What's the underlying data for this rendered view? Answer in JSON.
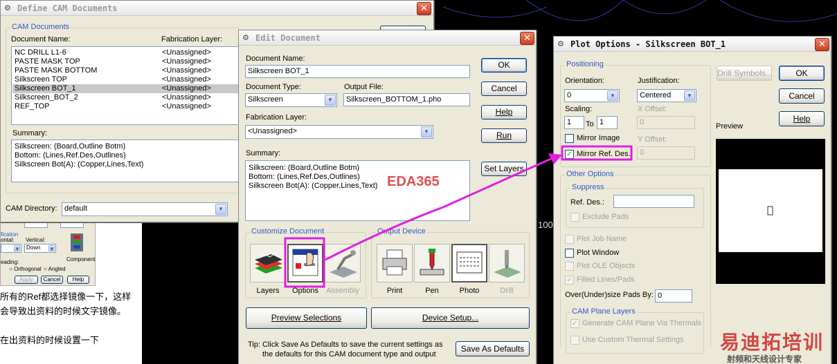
{
  "background": {
    "canvas_label": "100"
  },
  "behind_panel": {
    "label_fication": "fication",
    "label_ontal": "ontal:",
    "label_vertical": "Vertical:",
    "vertical_value": "Down",
    "label_eading": "eading:",
    "radio_orthogonal": "Orthogonal",
    "radio_angled": "Angled",
    "component_label": "Component",
    "btn_apply": "Apply",
    "btn_cancel": "Cancel",
    "btn_help": "Help",
    "note_line1": "所有的Ref都选择镜像一下，这样",
    "note_line2": "会导致出资料的时候文字镜像。",
    "note_line3": "在出资料的时候设置一下"
  },
  "define_cam": {
    "title": "Define CAM Documents",
    "group_label": "CAM Documents",
    "col_doc_name": "Document Name:",
    "col_fab_layer": "Fabrication Layer:",
    "documents": [
      {
        "name": "NC DRILL L1-6",
        "layer": "<Unassigned>"
      },
      {
        "name": "PASTE MASK TOP",
        "layer": "<Unassigned>"
      },
      {
        "name": "PASTE MASK BOTTOM",
        "layer": "<Unassigned>"
      },
      {
        "name": "Silkscreen TOP",
        "layer": "<Unassigned>"
      },
      {
        "name": "Silkscreen BOT_1",
        "layer": "<Unassigned>"
      },
      {
        "name": "Silkscreen_BOT_2",
        "layer": "<Unassigned>"
      },
      {
        "name": "REF_TOP",
        "layer": "<Unassigned>"
      }
    ],
    "summary_label": "Summary:",
    "summary_text": "Silkscreen: (Board,Outline Botm)\nBottom: (Lines,Ref.Des,Outlines)\nSilkscreen Bot(A): (Copper,Lines,Text)",
    "cam_dir_label": "CAM Directory:",
    "cam_dir_value": "default"
  },
  "edit_doc": {
    "title": "Edit Document",
    "doc_name_label": "Document Name:",
    "doc_name_value": "Silkscreen BOT_1",
    "doc_type_label": "Document Type:",
    "doc_type_value": "Silkscreen",
    "output_file_label": "Output File:",
    "output_file_value": "Silkscreen_BOTTOM_1.pho",
    "fab_layer_label": "Fabrication Layer:",
    "fab_layer_value": "<Unassigned>",
    "summary_label": "Summary:",
    "summary_text": "Silkscreen: (Board,Outline Botm)\nBottom: (Lines,Ref.Des,Outlines)\nSilkscreen Bot(A): (Copper,Lines,Text)",
    "watermark": "EDA365",
    "btn_ok": "OK",
    "btn_cancel": "Cancel",
    "btn_help": "Help",
    "btn_run": "Run",
    "btn_set_layers": "Set Layers",
    "customize_label": "Customize Document",
    "tool_layers": "Layers",
    "tool_options": "Options",
    "tool_assembly": "Assembly",
    "output_device_label": "Output Device",
    "dev_print": "Print",
    "dev_pen": "Pen",
    "dev_photo": "Photo",
    "dev_drill": "Drill",
    "btn_preview": "Preview Selections",
    "btn_device_setup": "Device Setup...",
    "tip_line1": "Tip: Click Save As Defaults to save the current settings as",
    "tip_line2": "the defaults for this CAM document type and output",
    "btn_save_defaults": "Save As Defaults"
  },
  "plot_opts": {
    "title": "Plot Options - Silkscreen BOT_1",
    "positioning_label": "Positioning",
    "orientation_label": "Orientation:",
    "orientation_value": "0",
    "justification_label": "Justification:",
    "justification_value": "Centered",
    "scaling_label": "Scaling:",
    "scale_from": "1",
    "to_label": "To",
    "scale_to": "1",
    "x_offset_label": "X Offset:",
    "x_offset_value": "0",
    "y_offset_label": "Y Offset:",
    "y_offset_value": "0",
    "mirror_image_label": "Mirror Image",
    "mirror_image_checked": false,
    "mirror_ref_label": "Mirror Ref. Des.",
    "mirror_ref_checked": true,
    "btn_drill_symbols": "Drill Symbols...",
    "btn_ok": "OK",
    "btn_cancel": "Cancel",
    "btn_help": "Help",
    "preview_label": "Preview",
    "other_options_label": "Other Options",
    "suppress_label": "Suppress",
    "ref_des_label": "Ref. Des.:",
    "ref_des_value": "",
    "exclude_pads_label": "Exclude Pads",
    "plot_job_name_label": "Plot Job Name",
    "plot_window_label": "Plot Window",
    "plot_ole_label": "Plot OLE Objects",
    "filled_lines_label": "Filled Lines/Pads",
    "filled_lines_checked": true,
    "overunder_label": "Over(Under)size Pads By:",
    "overunder_value": "0",
    "cam_plane_label": "CAM Plane Layers",
    "gen_cam_plane_label": "Generate CAM Plane Via Thermals",
    "gen_cam_plane_checked": true,
    "custom_thermal_label": "Use Custom Thermal Settings"
  },
  "site_watermark": {
    "line1": "易迪拓培训",
    "line2": "射频和天线设计专家"
  },
  "colors": {
    "accent_blue": "#2e57c8",
    "annotation_magenta": "#e020e0",
    "eda365_red": "#e05050"
  }
}
